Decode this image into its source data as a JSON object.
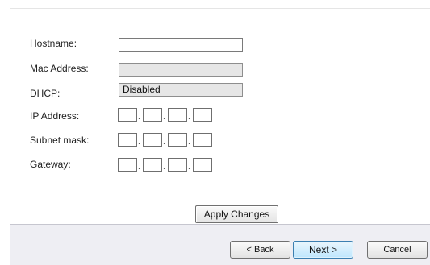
{
  "form": {
    "hostname": {
      "label": "Hostname:",
      "value": ""
    },
    "mac_address": {
      "label": "Mac Address:",
      "value": ""
    },
    "dhcp": {
      "label": "DHCP:",
      "value": "Disabled"
    },
    "ip_address": {
      "label": "IP Address:",
      "octets": [
        "",
        "",
        "",
        ""
      ]
    },
    "subnet_mask": {
      "label": "Subnet mask:",
      "octets": [
        "",
        "",
        "",
        ""
      ]
    },
    "gateway": {
      "label": "Gateway:",
      "octets": [
        "",
        "",
        "",
        ""
      ]
    },
    "apply_label": "Apply Changes"
  },
  "footer": {
    "back_label": "< Back",
    "next_label": "Next >",
    "cancel_label": "Cancel"
  },
  "colors": {
    "footer_bg": "#eeeef3",
    "next_accent": "#3c7fb1",
    "disabled_field": "#e6e6e6"
  }
}
